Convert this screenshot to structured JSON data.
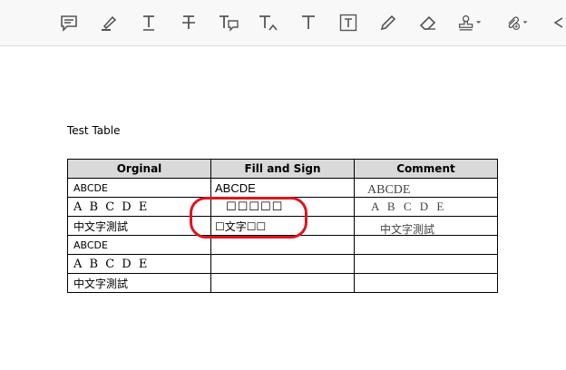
{
  "toolbar": {
    "tools": [
      {
        "icon": "comment-icon",
        "label": ""
      },
      {
        "icon": "highlight-icon",
        "label": ""
      },
      {
        "icon": "underline-text-icon",
        "label": ""
      },
      {
        "icon": "strikethrough-text-icon",
        "label": ""
      },
      {
        "icon": "replace-text-icon",
        "label": ""
      },
      {
        "icon": "insert-text-icon",
        "label": ""
      },
      {
        "icon": "add-text-comment-icon",
        "label": ""
      },
      {
        "icon": "text-box-icon",
        "label": ""
      },
      {
        "icon": "pencil-icon",
        "label": ""
      },
      {
        "icon": "eraser-icon",
        "label": ""
      },
      {
        "icon": "stamp-icon",
        "label": ""
      },
      {
        "icon": "attach-file-icon",
        "label": ""
      }
    ]
  },
  "document": {
    "title": "Test Table",
    "table": {
      "headers": [
        "Orginal",
        "Fill and Sign",
        "Comment"
      ],
      "rows": [
        [
          "ABCDE",
          "ABCDE",
          "ABCDE"
        ],
        [
          "A B C D E",
          "☐☐☐☐☐",
          "A B C D E"
        ],
        [
          "中文字測試",
          "☐文字☐☐",
          "中文字測試"
        ],
        [
          "ABCDE",
          "",
          ""
        ],
        [
          "A B C D E",
          "",
          ""
        ],
        [
          "中文字測試",
          "",
          ""
        ]
      ]
    }
  },
  "colors": {
    "header_bg": "#d9d9d9",
    "highlight_ring": "#e0141e",
    "icon": "#555555"
  }
}
